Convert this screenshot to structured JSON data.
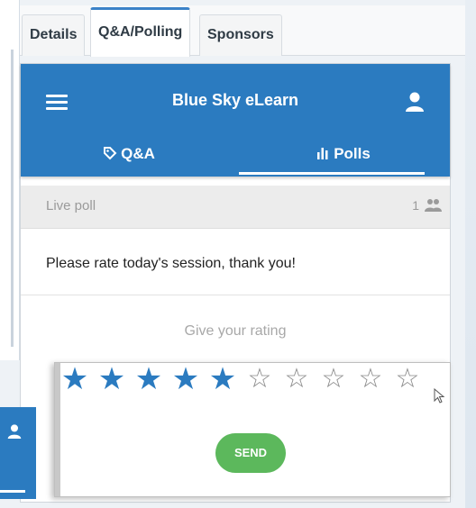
{
  "tabs": {
    "details": "Details",
    "qa_polling": "Q&A/Polling",
    "sponsors": "Sponsors"
  },
  "app": {
    "title": "Blue Sky eLearn",
    "tab_qa": "Q&A",
    "tab_polls": "Polls",
    "accent_color": "#2b7bc0"
  },
  "poll": {
    "status_label": "Live poll",
    "participant_count": "1",
    "question": "Please rate today's session, thank you!",
    "rating_prompt": "Give your rating",
    "rating_value": 5,
    "rating_max": 10,
    "send_label": "SEND",
    "send_color": "#5cb85c"
  },
  "icons": {
    "menu": "hamburger-icon",
    "user": "user-icon",
    "qa": "tag-icon",
    "polls": "bar-chart-icon",
    "participants": "people-icon"
  }
}
